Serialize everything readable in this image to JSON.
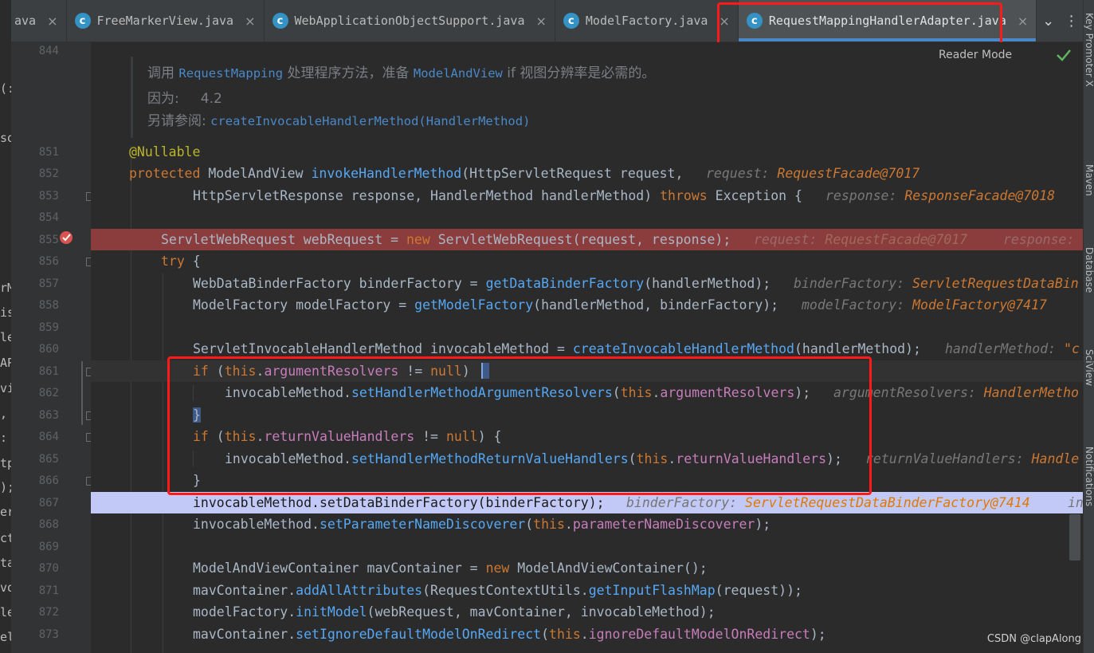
{
  "tabs": [
    {
      "label": "ava",
      "icon": "java-class-icon"
    },
    {
      "label": "FreeMarkerView.java",
      "icon": "java-class-icon"
    },
    {
      "label": "WebApplicationObjectSupport.java",
      "icon": "java-class-icon"
    },
    {
      "label": "ModelFactory.java",
      "icon": "java-class-icon"
    },
    {
      "label": "RequestMappingHandlerAdapter.java",
      "icon": "java-class-icon",
      "active": true
    }
  ],
  "tab_close_glyph": "×",
  "tabbar_buttons": {
    "more_tabs": "⌄",
    "menu": "⋮"
  },
  "reader_mode_label": "Reader Mode",
  "right_tool_windows": [
    "Key Promoter X",
    "Maven",
    "Database",
    "SciView",
    "Notifications"
  ],
  "left_strip_fragments": [
    "(:",
    "so",
    "rM",
    "is",
    "le",
    "AP",
    "vi",
    ",",
    ":",
    "tp",
    ");",
    "er",
    "ct",
    "ta",
    "vo",
    "le",
    "el"
  ],
  "doc_comment": {
    "line_number": "844",
    "text_prefix": "调用",
    "link1": "RequestMapping",
    "text_mid": "处理程序方法，准备",
    "link2": "ModelAndView",
    "text_if": "if",
    "text_suffix": "视图分辨率是必需的。",
    "since_label": "因为:",
    "since_value": "4.2",
    "see_label": "另请参阅:",
    "see_link": "createInvocableHandlerMethod(HandlerMethod)"
  },
  "line_numbers": [
    "851",
    "852",
    "853",
    "854",
    "855",
    "856",
    "857",
    "858",
    "859",
    "860",
    "861",
    "862",
    "863",
    "864",
    "865",
    "866",
    "867",
    "868",
    "869",
    "870",
    "871",
    "872",
    "873"
  ],
  "inline_hints": {
    "l852": {
      "label": "request:",
      "value": "RequestFacade@7017"
    },
    "l853": {
      "label": "response:",
      "value": "ResponseFacade@7018"
    },
    "l855a": {
      "label": "request:",
      "value": "RequestFacade@7017"
    },
    "l855b": {
      "label": "response:",
      "value": ""
    },
    "l857": {
      "label": "binderFactory:",
      "value": "ServletRequestDataBin"
    },
    "l858": {
      "label": "modelFactory:",
      "value": "ModelFactory@7417"
    },
    "l860": {
      "label": "handlerMethod:",
      "value": "\"c"
    },
    "l862": {
      "label": "argumentResolvers:",
      "value": "HandlerMetho"
    },
    "l865": {
      "label": "returnValueHandlers:",
      "value": "Handle"
    },
    "l867": {
      "label": "binderFactory:",
      "value": "ServletRequestDataBinderFactory@7414",
      "extra": "in"
    }
  },
  "watermark": "CSDN @clapAlong",
  "colors": {
    "editor_bg": "#2b2b2b",
    "keyword": "#cc7832",
    "method": "#56a8f5",
    "field": "#c77dbb",
    "annotation": "#bbb529",
    "breakpoint_line": "#8b3c3c",
    "execution_line": "#c2c9f6",
    "annotation_box": "#ff1a1a"
  }
}
